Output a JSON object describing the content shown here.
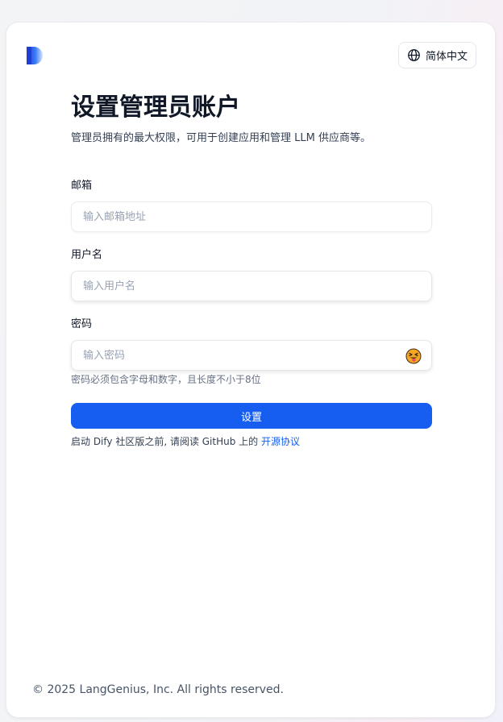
{
  "header": {
    "language_label": "简体中文",
    "logo_icon": "dify-logo-icon",
    "globe_icon": "globe-icon"
  },
  "form": {
    "title": "设置管理员账户",
    "subtitle": "管理员拥有的最大权限，可用于创建应用和管理 LLM 供应商等。",
    "email_label": "邮箱",
    "email_placeholder": "输入邮箱地址",
    "email_value": "",
    "username_label": "用户名",
    "username_placeholder": "输入用户名",
    "username_value": "",
    "password_label": "密码",
    "password_placeholder": "输入密码",
    "password_value": "",
    "password_toggle_icon": "emoji-toggle-icon",
    "password_hint": "密码必须包含字母和数字，且长度不小于8位",
    "submit_label": "设置",
    "terms_prefix": "启动 Dify 社区版之前, 请阅读 GitHub 上的 ",
    "terms_link": "开源协议"
  },
  "footer": {
    "copyright": "© 2025 LangGenius, Inc. All rights reserved."
  },
  "colors": {
    "primary": "#155eef",
    "text": "#101828",
    "muted": "#667085",
    "border": "#eaecf0"
  }
}
